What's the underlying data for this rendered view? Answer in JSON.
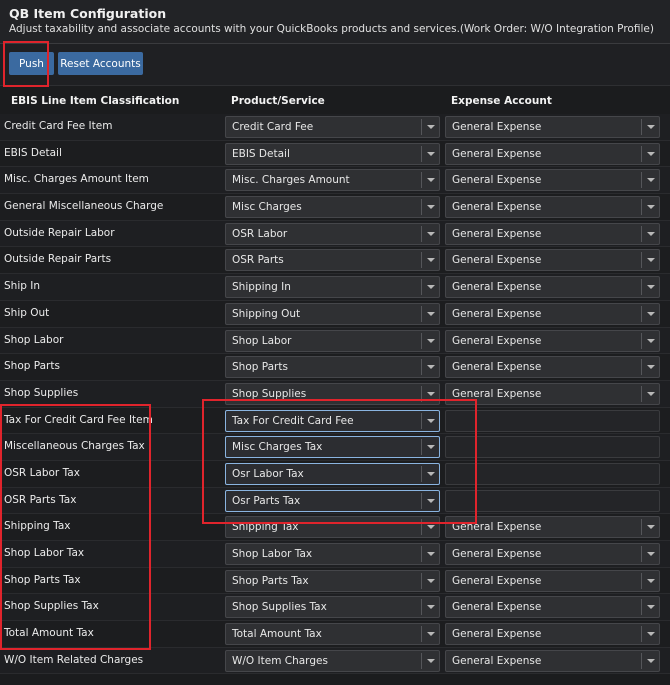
{
  "header": {
    "title": "QB Item Configuration",
    "subtitle": "Adjust taxability and associate accounts with your QuickBooks products and services.(Work Order: W/O Integration Profile)"
  },
  "toolbar": {
    "push_label": "Push",
    "reset_label": "Reset Accounts"
  },
  "columns": {
    "classification": "EBIS Line Item Classification",
    "product": "Product/Service",
    "expense": "Expense Account"
  },
  "rows": [
    {
      "label": "Credit Card Fee Item",
      "product": "Credit Card Fee",
      "expense": "General Expense"
    },
    {
      "label": "EBIS Detail",
      "product": "EBIS Detail",
      "expense": "General Expense"
    },
    {
      "label": "Misc. Charges Amount Item",
      "product": "Misc. Charges Amount",
      "expense": "General Expense"
    },
    {
      "label": "General Miscellaneous Charge",
      "product": "Misc Charges",
      "expense": "General Expense"
    },
    {
      "label": "Outside Repair Labor",
      "product": "OSR Labor",
      "expense": "General Expense"
    },
    {
      "label": "Outside Repair Parts",
      "product": "OSR Parts",
      "expense": "General Expense"
    },
    {
      "label": "Ship In",
      "product": "Shipping In",
      "expense": "General Expense"
    },
    {
      "label": "Ship Out",
      "product": "Shipping Out",
      "expense": "General Expense"
    },
    {
      "label": "Shop Labor",
      "product": "Shop Labor",
      "expense": "General Expense"
    },
    {
      "label": "Shop Parts",
      "product": "Shop Parts",
      "expense": "General Expense"
    },
    {
      "label": "Shop Supplies",
      "product": "Shop Supplies",
      "expense": "General Expense"
    },
    {
      "label": "Tax For Credit Card Fee Item",
      "product": "Tax For Credit Card Fee",
      "expense": ""
    },
    {
      "label": "Miscellaneous Charges Tax",
      "product": "Misc Charges Tax",
      "expense": ""
    },
    {
      "label": "OSR Labor Tax",
      "product": "Osr Labor Tax",
      "expense": ""
    },
    {
      "label": "OSR Parts Tax",
      "product": "Osr Parts Tax",
      "expense": ""
    },
    {
      "label": "Shipping Tax",
      "product": "Shipping Tax",
      "expense": "General Expense"
    },
    {
      "label": "Shop Labor Tax",
      "product": "Shop Labor Tax",
      "expense": "General Expense"
    },
    {
      "label": "Shop Parts Tax",
      "product": "Shop Parts Tax",
      "expense": "General Expense"
    },
    {
      "label": "Shop Supplies Tax",
      "product": "Shop Supplies Tax",
      "expense": "General Expense"
    },
    {
      "label": "Total Amount Tax",
      "product": "Total Amount Tax",
      "expense": "General Expense"
    },
    {
      "label": "W/O Item Related Charges",
      "product": "W/O Item Charges",
      "expense": "General Expense"
    }
  ],
  "colors": {
    "background": "#1b1c1e",
    "button": "#3b6aa0",
    "annotation": "#e0242c",
    "focus_border": "#8ab4e0"
  },
  "icons": {
    "dropdown": "chevron-down-icon"
  }
}
